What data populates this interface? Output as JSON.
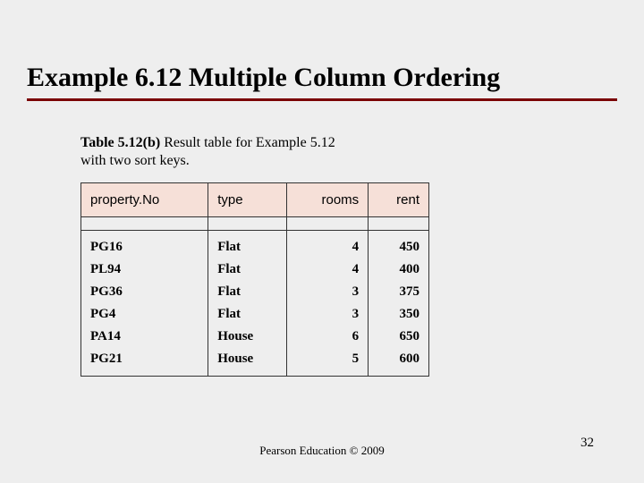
{
  "title": "Example 6.12  Multiple Column Ordering",
  "caption": {
    "table_label": "Table 5.12(b)",
    "text_line1_rest": "   Result table for Example 5.12",
    "text_line2": "with two sort keys."
  },
  "chart_data": {
    "type": "table",
    "columns": [
      "property.No",
      "type",
      "rooms",
      "rent"
    ],
    "rows": [
      {
        "propertyNo": "PG16",
        "type": "Flat",
        "rooms": 4,
        "rent": 450
      },
      {
        "propertyNo": "PL94",
        "type": "Flat",
        "rooms": 4,
        "rent": 400
      },
      {
        "propertyNo": "PG36",
        "type": "Flat",
        "rooms": 3,
        "rent": 375
      },
      {
        "propertyNo": "PG4",
        "type": "Flat",
        "rooms": 3,
        "rent": 350
      },
      {
        "propertyNo": "PA14",
        "type": "House",
        "rooms": 6,
        "rent": 650
      },
      {
        "propertyNo": "PG21",
        "type": "House",
        "rooms": 5,
        "rent": 600
      }
    ]
  },
  "footer": "Pearson Education © 2009",
  "page_number": "32"
}
